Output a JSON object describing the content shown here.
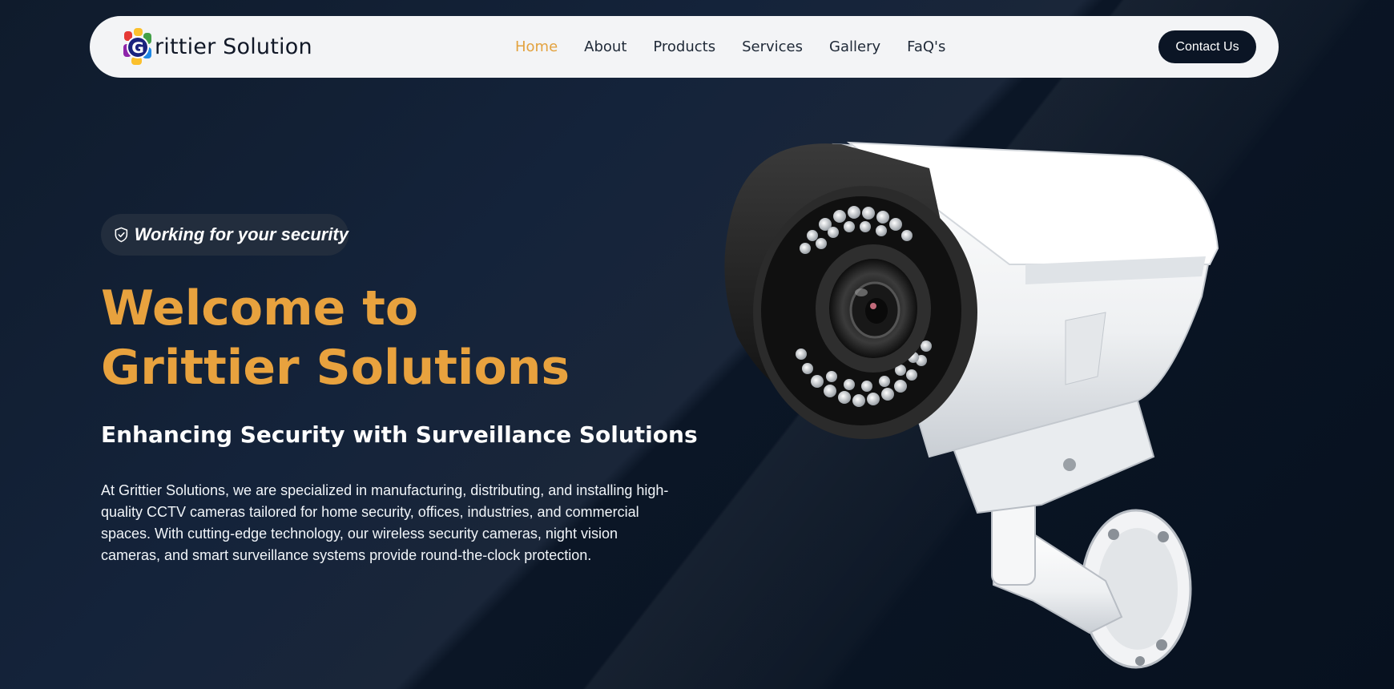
{
  "brand": {
    "name": "rittier Solution",
    "logo_letter": "G",
    "logo_colors": [
      "#e53935",
      "#fbc02d",
      "#43a047",
      "#1e88e5",
      "#8e24aa"
    ]
  },
  "nav": {
    "items": [
      {
        "label": "Home",
        "active": true
      },
      {
        "label": "About",
        "active": false
      },
      {
        "label": "Products",
        "active": false
      },
      {
        "label": "Services",
        "active": false
      },
      {
        "label": "Gallery",
        "active": false
      },
      {
        "label": "FaQ's",
        "active": false
      }
    ],
    "contact_label": "Contact Us"
  },
  "hero": {
    "badge_icon": "shield-check-icon",
    "badge_text": "Working for your security",
    "title_line1": "Welcome to",
    "title_line2": "Grittier Solutions",
    "subtitle": "Enhancing Security with Surveillance Solutions",
    "description": "At Grittier Solutions, we are specialized in manufacturing, distributing, and installing high-quality CCTV cameras tailored for home security, offices, industries, and commercial spaces. With cutting-edge technology, our wireless security cameras, night vision cameras, and smart surveillance systems provide round-the-clock protection."
  },
  "colors": {
    "accent": "#e8a23e",
    "navbar_bg": "#f3f4f6",
    "page_bg": "#0d1726",
    "button_bg": "#0b1525"
  },
  "image": {
    "name": "cctv-camera-image"
  }
}
